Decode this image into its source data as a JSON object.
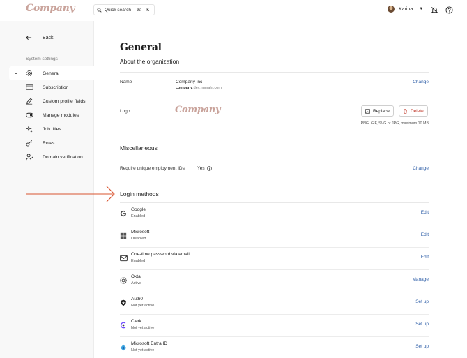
{
  "header": {
    "logo_text": "Company",
    "search_placeholder": "Quick search",
    "search_shortcut": "⌘ K",
    "user_name": "Karina"
  },
  "sidebar": {
    "back_label": "Back",
    "section_title": "System settings",
    "items": [
      {
        "label": "General",
        "icon": "gear-icon",
        "active": true
      },
      {
        "label": "Subscription",
        "icon": "credit-card-icon"
      },
      {
        "label": "Custom profile fields",
        "icon": "pencil-icon"
      },
      {
        "label": "Manage modules",
        "icon": "toggle-icon"
      },
      {
        "label": "Job titles",
        "icon": "sparkle-icon"
      },
      {
        "label": "Roles",
        "icon": "key-icon"
      },
      {
        "label": "Domain verification",
        "icon": "user-check-icon"
      }
    ]
  },
  "main": {
    "title": "General",
    "about": {
      "heading": "About the organization",
      "name_label": "Name",
      "org_name": "Company Inc",
      "org_subdomain": "company",
      "org_domain_rest": ".dev.humahr.com",
      "name_action": "Change",
      "logo_label": "Logo",
      "logo_text": "Company",
      "replace_label": "Replace",
      "delete_label": "Delete",
      "logo_hint": "PNG, GIF, SVG or JPG, maximum 10 MB"
    },
    "misc": {
      "heading": "Miscellaneous",
      "employment_label": "Require unique employment IDs",
      "employment_value": "Yes",
      "employment_action": "Change"
    },
    "login": {
      "heading": "Login methods",
      "methods": [
        {
          "name": "Google",
          "status": "Enabled",
          "action": "Edit",
          "icon": "google-icon"
        },
        {
          "name": "Microsoft",
          "status": "Disabled",
          "action": "Edit",
          "icon": "microsoft-icon"
        },
        {
          "name": "One-time password via email",
          "status": "Enabled",
          "action": "Edit",
          "icon": "mail-icon"
        },
        {
          "name": "Okta",
          "status": "Active",
          "action": "Manage",
          "icon": "okta-icon"
        },
        {
          "name": "Auth0",
          "status": "Not yet active",
          "action": "Set up",
          "icon": "auth0-icon"
        },
        {
          "name": "Clerk",
          "status": "Not yet active",
          "action": "Set up",
          "icon": "clerk-icon"
        },
        {
          "name": "Microsoft Entra ID",
          "status": "Not yet active",
          "action": "Set up",
          "icon": "entra-id-icon"
        }
      ]
    }
  },
  "colors": {
    "link": "#2f5fa8",
    "logo": "#c9a39b",
    "arrow": "#d9542f",
    "delete": "#c0392b"
  }
}
